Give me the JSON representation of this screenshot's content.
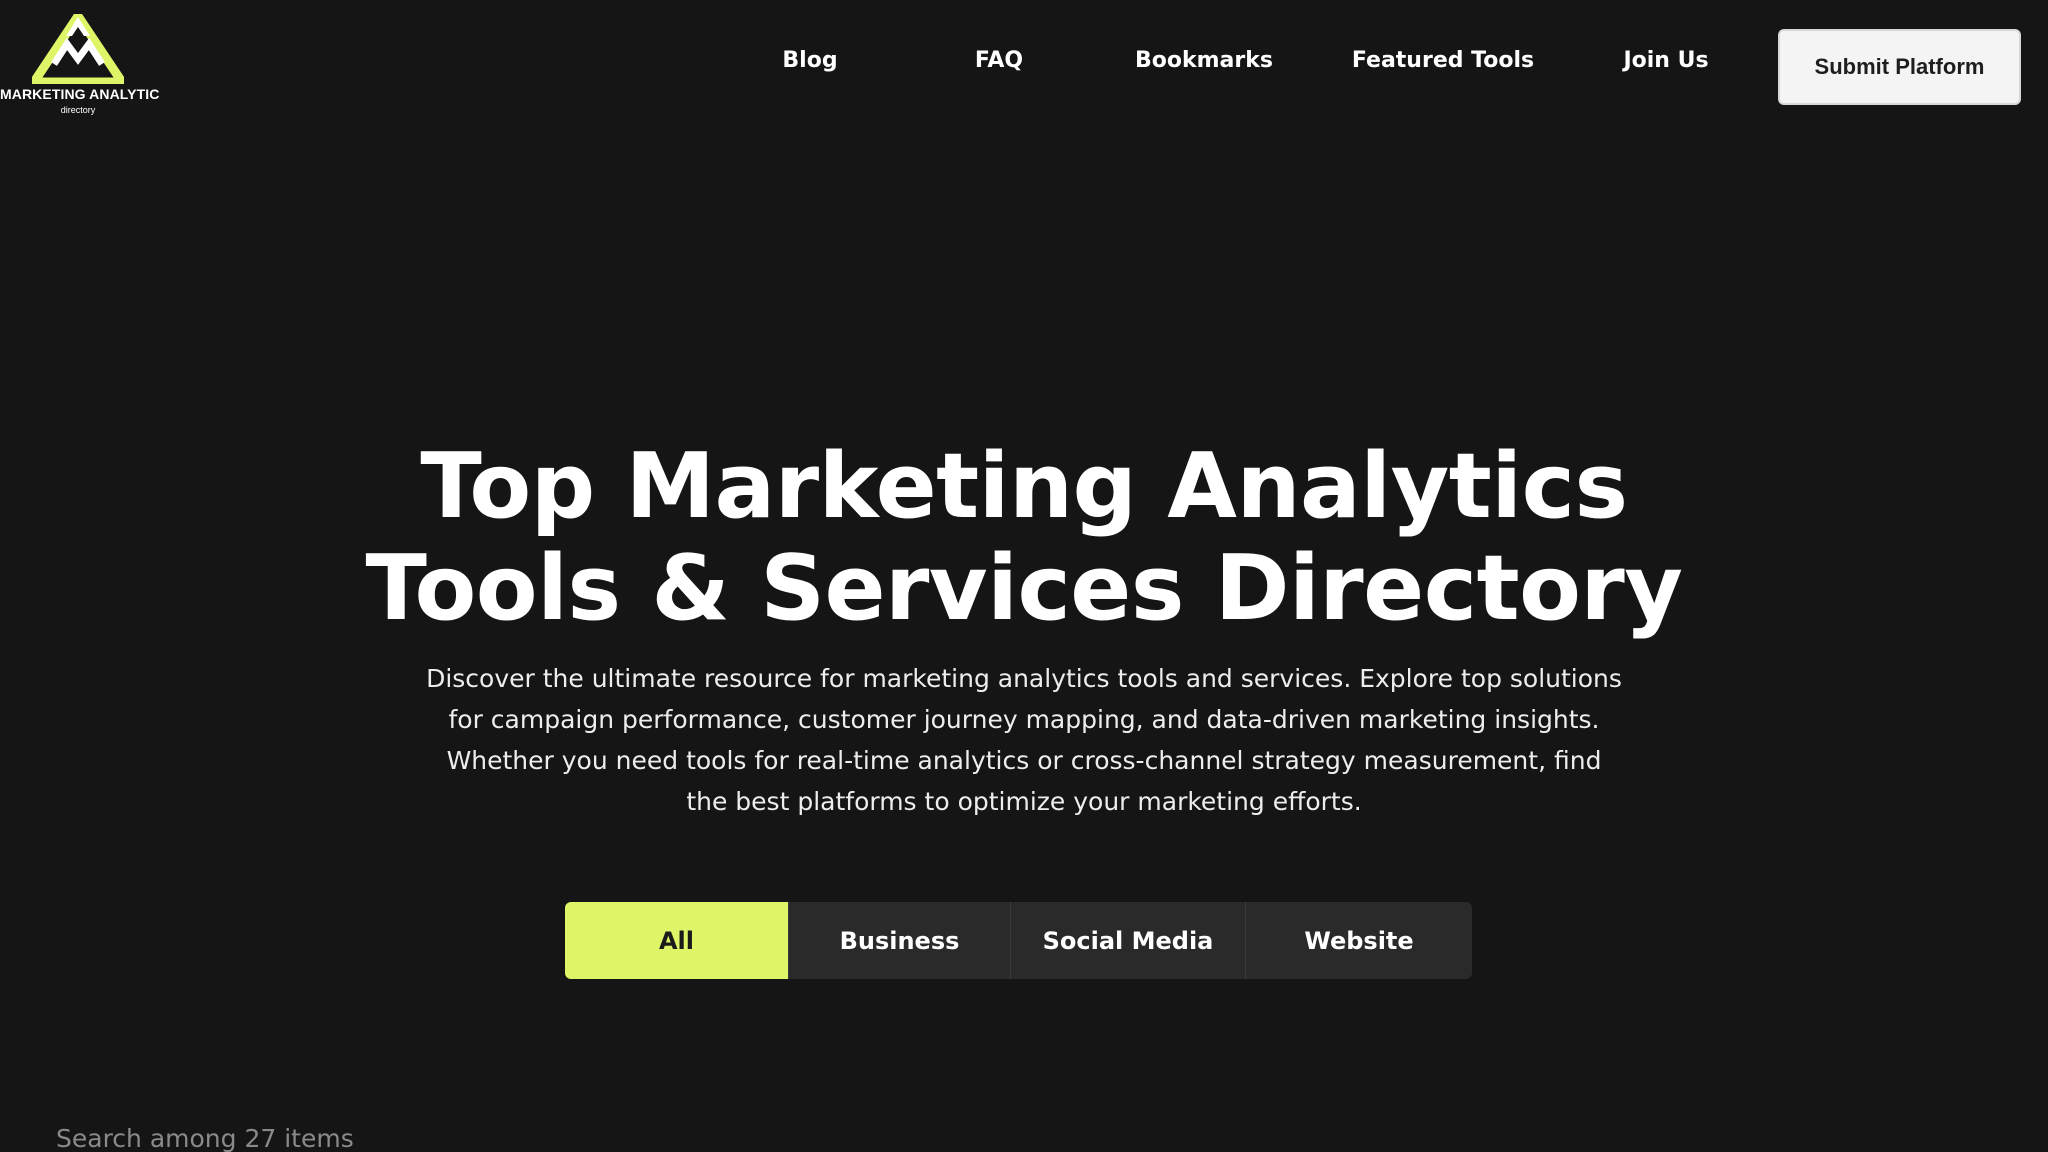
{
  "logo": {
    "title": "MARKETING ANALYTIC",
    "subtitle": "directory",
    "accent_color": "#dff567"
  },
  "nav": {
    "items": [
      "Blog",
      "FAQ",
      "Bookmarks",
      "Featured Tools",
      "Join Us"
    ],
    "submit_label": "Submit Platform"
  },
  "hero": {
    "title_line1": "Top Marketing Analytics",
    "title_line2": "Tools & Services Directory",
    "description": "Discover the ultimate resource for marketing analytics tools and services. Explore top solutions for campaign performance, customer journey mapping, and data-driven marketing insights. Whether you need tools for real-time analytics or cross-channel strategy measurement, find the best platforms to optimize your marketing efforts."
  },
  "tabs": {
    "items": [
      "All",
      "Business",
      "Social Media",
      "Website"
    ],
    "active": "All",
    "active_color": "#dff567"
  },
  "search": {
    "placeholder": "Search among 27 items"
  }
}
